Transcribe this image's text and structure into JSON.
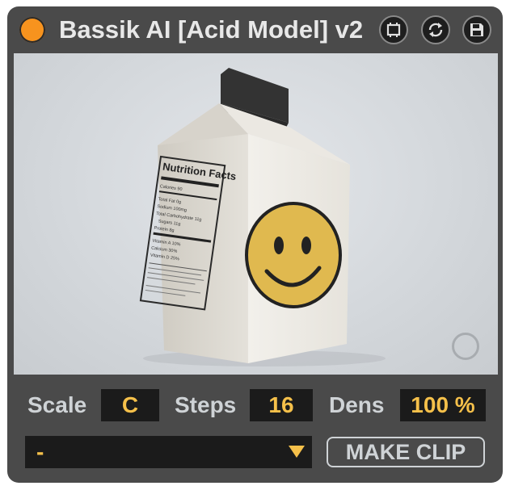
{
  "window": {
    "title": "Bassik AI [Acid Model] v2"
  },
  "titlebar": {
    "buttons": [
      {
        "icon": "fit-frame-icon"
      },
      {
        "icon": "refresh-icon"
      },
      {
        "icon": "save-icon"
      }
    ],
    "power_color": "#f7931e"
  },
  "viewport": {
    "carton": {
      "nutrition_heading": "Nutrition Facts",
      "rows": [
        "Calories 90",
        "Total Fat 0g",
        "Sodium 100mg",
        "Total Carbohydrate 11g",
        "Sugars 11g",
        "Protein 8g",
        "Vitamin A 10%",
        "Calcium 30%",
        "Vitamin D 25%"
      ],
      "face_color": "#e0b94f"
    }
  },
  "controls": {
    "scale_label": "Scale",
    "scale_value": "C",
    "steps_label": "Steps",
    "steps_value": "16",
    "density_label": "Dens",
    "density_value": "100 %",
    "pattern_selected": "-",
    "make_clip_label": "MAKE CLIP",
    "accent_color": "#f5c04a"
  }
}
